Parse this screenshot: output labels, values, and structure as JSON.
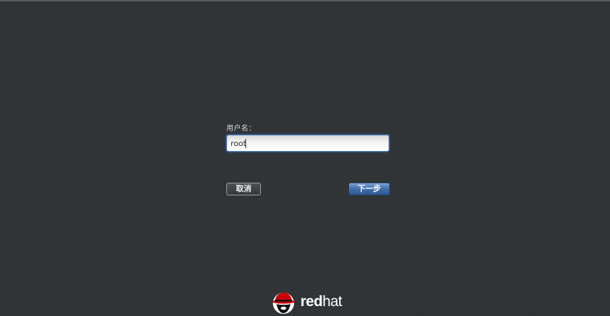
{
  "login": {
    "username_label": "用户名：",
    "username_value": "root"
  },
  "buttons": {
    "cancel_label": "取消",
    "next_label": "下一步"
  },
  "brand": {
    "name_bold": "red",
    "name_regular": "hat",
    "logo_icon": "redhat-shadowman-icon"
  },
  "colors": {
    "background": "#2f3336",
    "next_button": "#3f6ba6",
    "logo_red": "#cc0000"
  }
}
